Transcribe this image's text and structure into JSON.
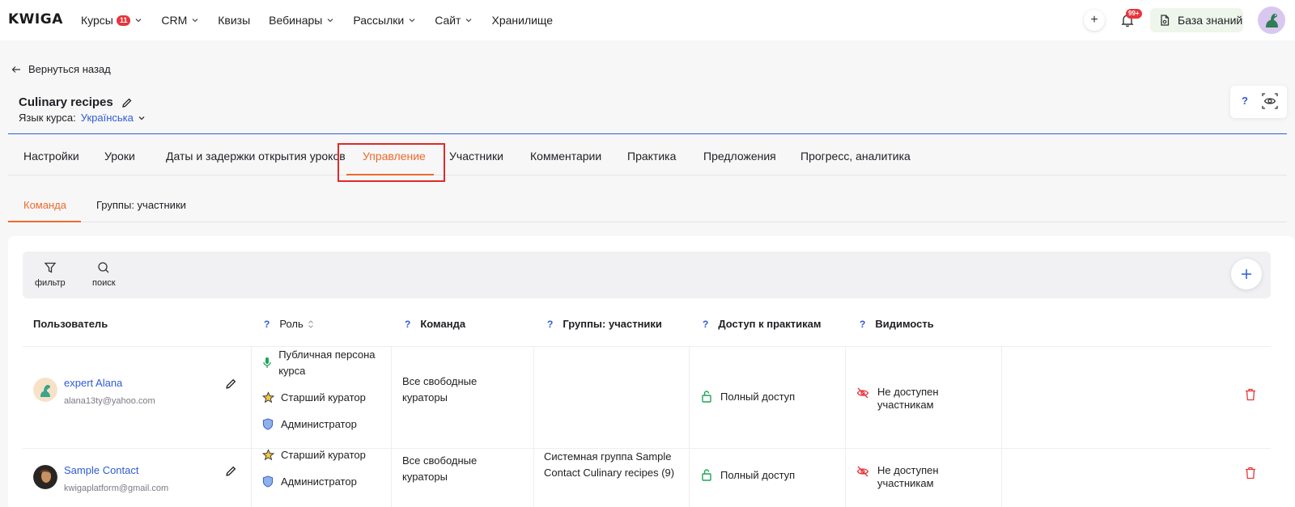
{
  "brand": "KWIGA",
  "nav": [
    {
      "label": "Курсы",
      "badge": "11",
      "dropdown": true
    },
    {
      "label": "CRM",
      "dropdown": true
    },
    {
      "label": "Квизы",
      "dropdown": false
    },
    {
      "label": "Вебинары",
      "dropdown": true
    },
    {
      "label": "Рассылки",
      "dropdown": true
    },
    {
      "label": "Сайт",
      "dropdown": true
    },
    {
      "label": "Хранилище",
      "dropdown": false
    }
  ],
  "topright": {
    "plus": "+",
    "notif_badge": "99+",
    "kb_label": "База знаний"
  },
  "back_label": "Вернуться назад",
  "course": {
    "title": "Culinary recipes",
    "lang_label": "Язык курса:",
    "lang_value": "Українська"
  },
  "float_help": "?",
  "tabs": [
    "Настройки",
    "Уроки",
    "Даты и задержки открытия уроков",
    "Управление",
    "Участники",
    "Комментарии",
    "Практика",
    "Предложения",
    "Прогресс, аналитика"
  ],
  "active_tab": "Управление",
  "subtabs": [
    "Команда",
    "Группы: участники"
  ],
  "toolbar": {
    "filter_label": "фильтр",
    "search_label": "поиск"
  },
  "table": {
    "headers": {
      "user": "Пользователь",
      "role": "Роль",
      "team": "Команда",
      "groups": "Группы: участники",
      "practice": "Доступ к практикам",
      "visibility": "Видимость",
      "help": "?"
    },
    "rows": [
      {
        "name": "expert Alana",
        "email": "alana13ty@yahoo.com",
        "roles": [
          "Публичная персона курса",
          "Старший куратор",
          "Администратор"
        ],
        "team": "Все свободные кураторы",
        "groups": "",
        "practice": "Полный доступ",
        "visibility": "Не доступен участникам"
      },
      {
        "name": "Sample Contact",
        "email": "kwigaplatform@gmail.com",
        "roles": [
          "Старший куратор",
          "Администратор"
        ],
        "team": "Все свободные кураторы",
        "groups": "Системная группа Sample Contact Culinary recipes (9)",
        "practice": "Полный доступ",
        "visibility": "Не доступен участникам"
      }
    ]
  },
  "colors": {
    "accent": "#ef6a2a",
    "link": "#2f5bd6",
    "danger": "#e8343a",
    "success": "#1fa35c"
  }
}
